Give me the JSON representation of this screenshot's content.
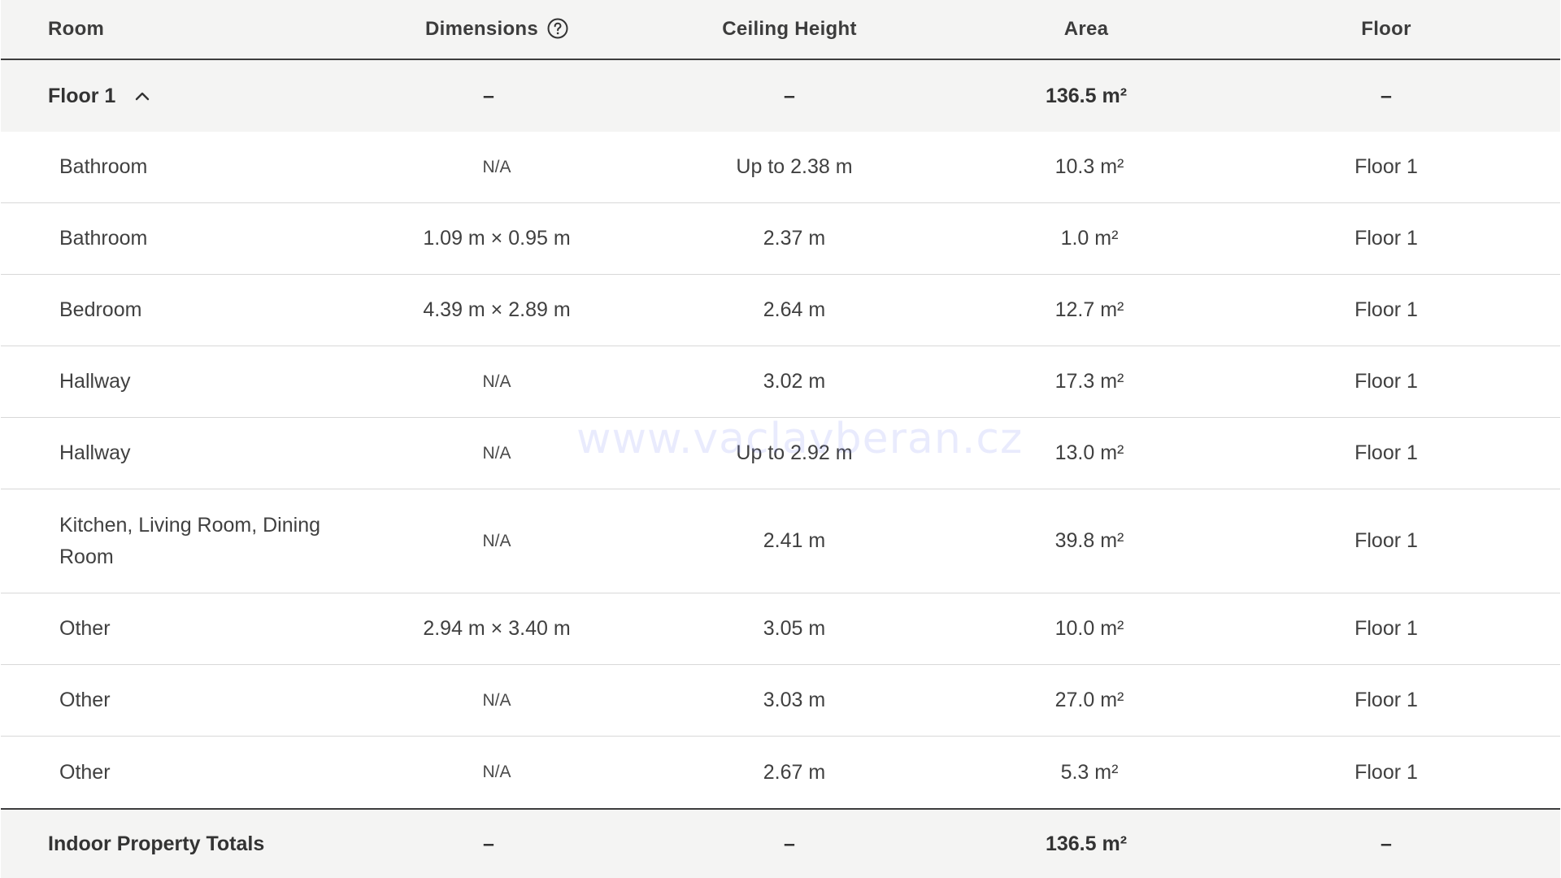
{
  "header": {
    "room": "Room",
    "dimensions": "Dimensions",
    "ceiling_height": "Ceiling Height",
    "area": "Area",
    "floor": "Floor"
  },
  "group": {
    "label": "Floor 1",
    "dimensions": "–",
    "ceiling_height": "–",
    "area": "136.5 m²",
    "floor": "–"
  },
  "rows": [
    {
      "room": "Bathroom",
      "dimensions": "N/A",
      "ceiling_height": "Up to 2.38 m",
      "area": "10.3 m²",
      "floor": "Floor 1"
    },
    {
      "room": "Bathroom",
      "dimensions": "1.09 m × 0.95 m",
      "ceiling_height": "2.37 m",
      "area": "1.0 m²",
      "floor": "Floor 1"
    },
    {
      "room": "Bedroom",
      "dimensions": "4.39 m × 2.89 m",
      "ceiling_height": "2.64 m",
      "area": "12.7 m²",
      "floor": "Floor 1"
    },
    {
      "room": "Hallway",
      "dimensions": "N/A",
      "ceiling_height": "3.02 m",
      "area": "17.3 m²",
      "floor": "Floor 1"
    },
    {
      "room": "Hallway",
      "dimensions": "N/A",
      "ceiling_height": "Up to 2.92 m",
      "area": "13.0 m²",
      "floor": "Floor 1"
    },
    {
      "room": "Kitchen, Living Room, Dining Room",
      "dimensions": "N/A",
      "ceiling_height": "2.41 m",
      "area": "39.8 m²",
      "floor": "Floor 1"
    },
    {
      "room": "Other",
      "dimensions": "2.94 m × 3.40 m",
      "ceiling_height": "3.05 m",
      "area": "10.0 m²",
      "floor": "Floor 1"
    },
    {
      "room": "Other",
      "dimensions": "N/A",
      "ceiling_height": "3.03 m",
      "area": "27.0 m²",
      "floor": "Floor 1"
    },
    {
      "room": "Other",
      "dimensions": "N/A",
      "ceiling_height": "2.67 m",
      "area": "5.3 m²",
      "floor": "Floor 1"
    }
  ],
  "totals": {
    "label": "Indoor Property Totals",
    "dimensions": "–",
    "ceiling_height": "–",
    "area": "136.5 m²",
    "floor": "–"
  },
  "watermark": "www.vaclavberan.cz",
  "icons": {
    "dimensions_help": "question-circle-icon",
    "group_toggle": "chevron-up-icon"
  }
}
